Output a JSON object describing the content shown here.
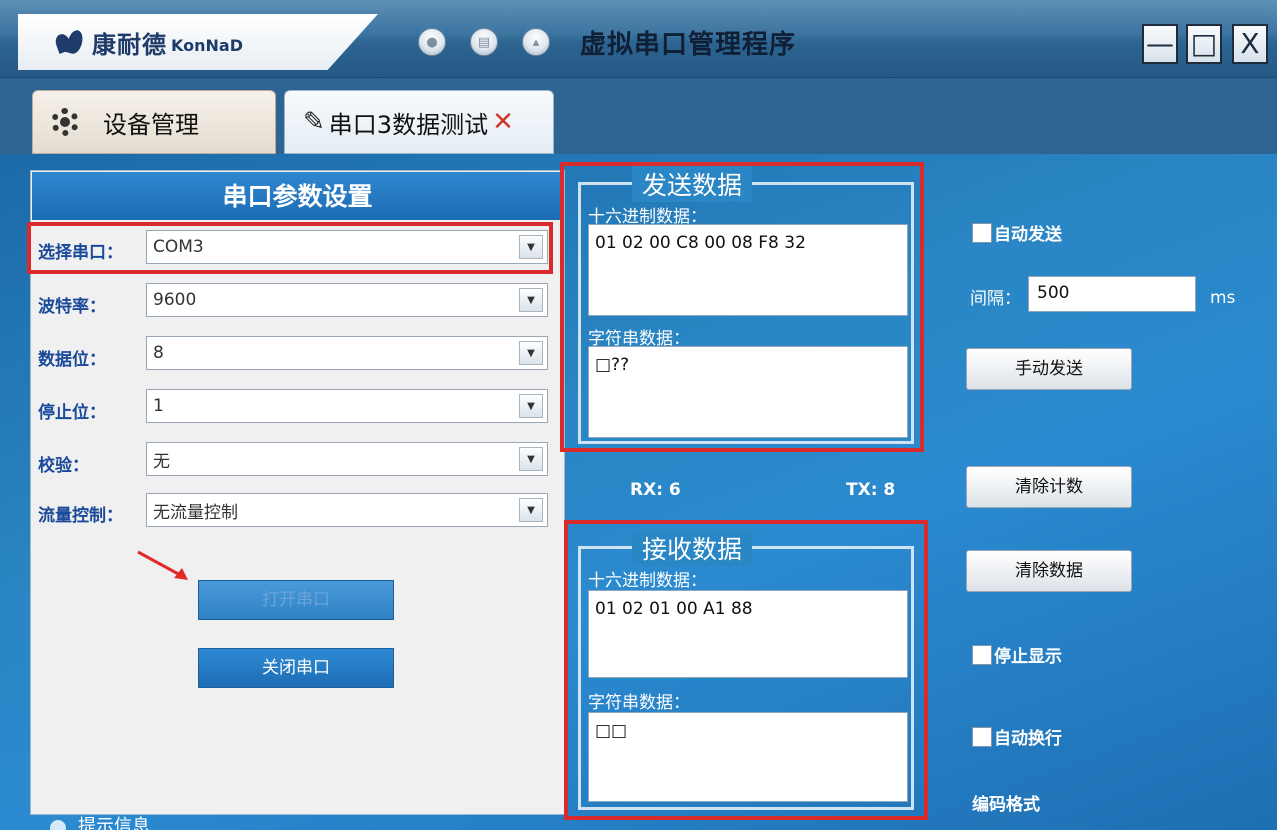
{
  "window": {
    "logo_cn": "康耐德",
    "logo_en": "KonNaD",
    "title": "虚拟串口管理程序",
    "controls": {
      "minimize": "—",
      "maximize": "□",
      "close": "X"
    },
    "colors": {
      "titlebar": "#2d6491",
      "main_bg": "#2a86c4",
      "highlight": "#d92b2b"
    }
  },
  "tabs": [
    {
      "label": "设备管理",
      "icon": "gear-icon"
    },
    {
      "label": "串口3数据测试",
      "icon": "plug-icon",
      "close": "✕"
    }
  ],
  "params": {
    "header": "串口参数设置",
    "port": {
      "label": "选择串口：",
      "value": "COM3"
    },
    "baud": {
      "label": "波特率：",
      "value": "9600"
    },
    "data": {
      "label": "数据位：",
      "value": "8"
    },
    "stop": {
      "label": "停止位：",
      "value": "1"
    },
    "parity": {
      "label": "校验：",
      "value": "无"
    },
    "flow": {
      "label": "流量控制：",
      "value": "无流量控制"
    },
    "open_button": "打开串口",
    "close_button": "关闭串口",
    "hint": "提示信息"
  },
  "send": {
    "title": "发送数据",
    "hex_label": "十六进制数据：",
    "hex_value": "01 02 00 C8 00 08 F8 32",
    "str_label": "字符串数据：",
    "str_value": "□??"
  },
  "counters": {
    "rx": "RX: 6",
    "tx": "TX:  8"
  },
  "receive": {
    "title": "接收数据",
    "hex_label": "十六进制数据：",
    "hex_value": "01 02 01 00 A1 88",
    "str_label": "字符串数据：",
    "str_value": "□□"
  },
  "controls": {
    "auto_send": "自动发送",
    "interval_label": "间隔：",
    "interval_value": "500",
    "interval_unit": "ms",
    "manual_send": "手动发送",
    "clear_count": "清除计数",
    "clear_data": "清除数据",
    "stop_display": "停止显示",
    "auto_wrap": "自动换行",
    "encoding_label": "编码格式"
  }
}
